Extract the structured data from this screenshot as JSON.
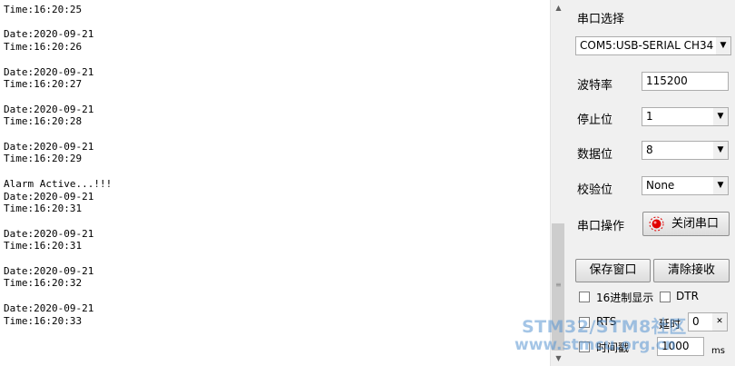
{
  "log": {
    "lines": [
      "Time:16:20:25",
      "",
      "Date:2020-09-21",
      "Time:16:20:26",
      "",
      "Date:2020-09-21",
      "Time:16:20:27",
      "",
      "Date:2020-09-21",
      "Time:16:20:28",
      "",
      "Date:2020-09-21",
      "Time:16:20:29",
      "",
      "Alarm Active...!!!",
      "Date:2020-09-21",
      "Time:16:20:31",
      "",
      "Date:2020-09-21",
      "Time:16:20:31",
      "",
      "Date:2020-09-21",
      "Time:16:20:32",
      "",
      "Date:2020-09-21",
      "Time:16:20:33"
    ]
  },
  "panel": {
    "port_label": "串口选择",
    "port_value": "COM5:USB-SERIAL CH34",
    "baud_label": "波特率",
    "baud_value": "115200",
    "stop_label": "停止位",
    "stop_value": "1",
    "data_label": "数据位",
    "data_value": "8",
    "parity_label": "校验位",
    "parity_value": "None",
    "op_label": "串口操作",
    "close_port_label": "关闭串口",
    "save_window_label": "保存窗口",
    "clear_recv_label": "清除接收",
    "hex_display_label": "16进制显示",
    "dtr_label": "DTR",
    "rts_label": "RTS",
    "delay_label": "延时",
    "delay_value": "0",
    "timestamp_label": "时间戳",
    "timestamp_value": "1000",
    "ms_label": "ms"
  },
  "watermark": {
    "line1": "STM32/STM8社区",
    "line2": "www.stmcu.org.cn"
  },
  "colors": {
    "indicator_red": "#e00000"
  }
}
